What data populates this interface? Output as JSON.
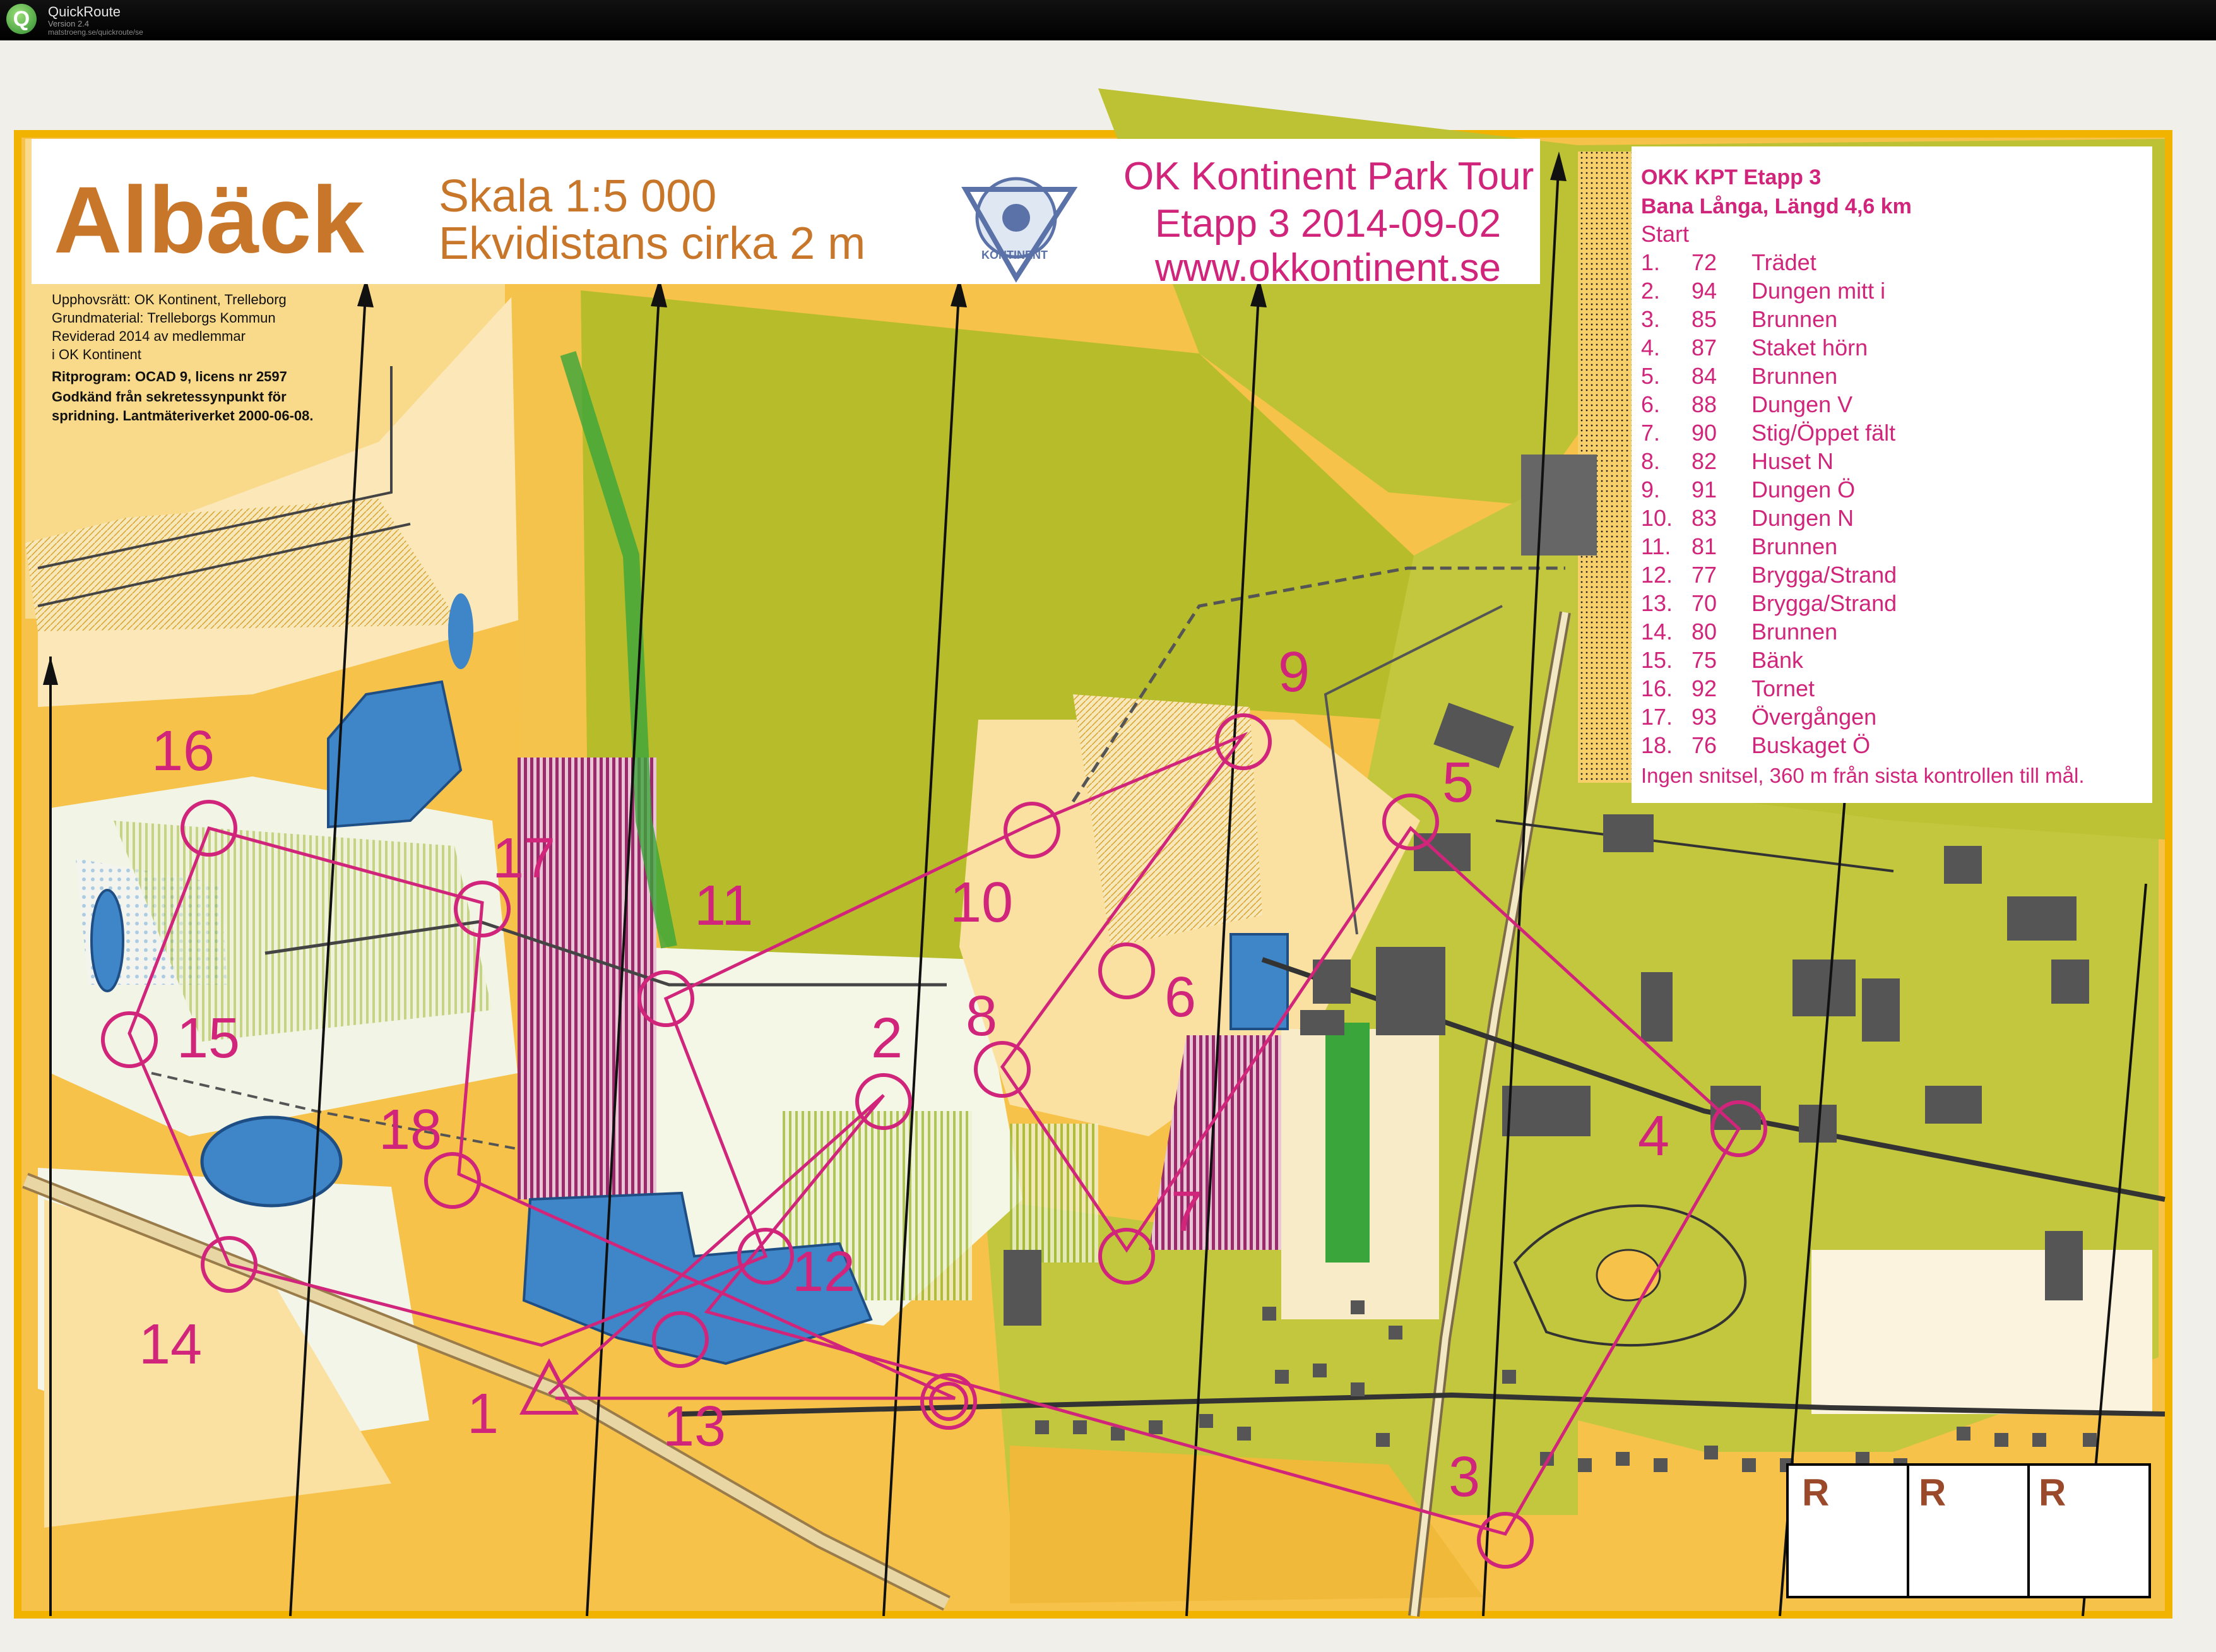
{
  "app": {
    "name": "QuickRoute",
    "version": "Version 2.4",
    "url": "matstroeng.se/quickroute/se"
  },
  "map": {
    "title": "Albäck",
    "scale": "Skala 1:5 000",
    "contour": "Ekvidistans cirka 2 m",
    "event_lines": [
      "OK Kontinent Park Tour",
      "Etapp 3 2014-09-02",
      "www.okkontinent.se"
    ],
    "logo_text": "KONTINENT",
    "credits": [
      "Upphovsrätt: OK Kontinent, Trelleborg",
      "Grundmaterial: Trelleborgs Kommun",
      "Reviderad 2014 av medlemmar",
      "i OK Kontinent",
      "Ritprogram: OCAD 9, licens nr 2597",
      "Godkänd från sekretessynpunkt för",
      "spridning. Lantmäteriverket 2000-06-08."
    ],
    "course": {
      "header1": "OKK KPT Etapp 3",
      "header2": "Bana Långa,  Längd 4,6 km",
      "start": "Start",
      "controls": [
        {
          "num": "1.",
          "code": "72",
          "desc": "Trädet"
        },
        {
          "num": "2.",
          "code": "94",
          "desc": "Dungen mitt i"
        },
        {
          "num": "3.",
          "code": "85",
          "desc": "Brunnen"
        },
        {
          "num": "4.",
          "code": "87",
          "desc": "Staket hörn"
        },
        {
          "num": "5.",
          "code": "84",
          "desc": "Brunnen"
        },
        {
          "num": "6.",
          "code": "88",
          "desc": "Dungen V"
        },
        {
          "num": "7.",
          "code": "90",
          "desc": "Stig/Öppet fält"
        },
        {
          "num": "8.",
          "code": "82",
          "desc": "Huset N"
        },
        {
          "num": "9.",
          "code": "91",
          "desc": "Dungen Ö"
        },
        {
          "num": "10.",
          "code": "83",
          "desc": "Dungen N"
        },
        {
          "num": "11.",
          "code": "81",
          "desc": "Brunnen"
        },
        {
          "num": "12.",
          "code": "77",
          "desc": "Brygga/Strand"
        },
        {
          "num": "13.",
          "code": "70",
          "desc": "Brygga/Strand"
        },
        {
          "num": "14.",
          "code": "80",
          "desc": "Brunnen"
        },
        {
          "num": "15.",
          "code": "75",
          "desc": "Bänk"
        },
        {
          "num": "16.",
          "code": "92",
          "desc": "Tornet"
        },
        {
          "num": "17.",
          "code": "93",
          "desc": "Övergången"
        },
        {
          "num": "18.",
          "code": "76",
          "desc": "Buskaget Ö"
        }
      ],
      "footer": "Ingen snitsel, 360 m från sista kontrollen till mål."
    },
    "control_labels": [
      "1",
      "2",
      "3",
      "4",
      "5",
      "6",
      "7",
      "8",
      "9",
      "10",
      "11",
      "12",
      "13",
      "14",
      "15",
      "16",
      "17",
      "18"
    ],
    "r_boxes": [
      "R",
      "R",
      "R"
    ],
    "colors": {
      "course": "#d0257a",
      "open": "#f6c24a",
      "forest": "#b7bd2a",
      "water": "#3f86c8",
      "building": "#555555",
      "frame": "#f2b300",
      "title": "#c8772a"
    }
  }
}
